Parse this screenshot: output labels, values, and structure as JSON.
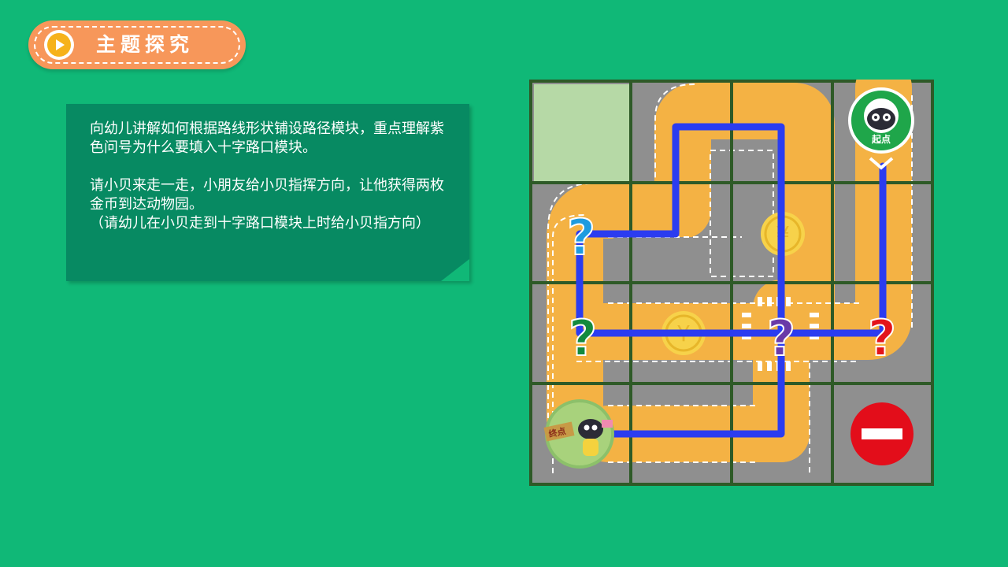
{
  "header": {
    "title": "主题探究",
    "play_icon": "play-icon"
  },
  "note": {
    "paragraph1": "向幼儿讲解如何根据路线形状铺设路径模块，重点理解紫色问号为什么要填入十字路口模块。",
    "paragraph2": "请小贝来走一走，小朋友给小贝指挥方向，让他获得两枚金币到达动物园。",
    "paragraph3": "（请幼儿在小贝走到十字路口模块上时给小贝指方向）"
  },
  "board": {
    "start_badge_text": "起点",
    "end_sign_text": "终点",
    "question_mark": "?",
    "coin_symbol": "¥",
    "colors": {
      "path_line": "#2b3cf0",
      "road": "#f4b244",
      "asphalt": "#8f8f8f",
      "grid": "#2e5a27",
      "empty_tile": "#b6d9a6",
      "q_blue": "#1e9be0",
      "q_green": "#138a3e",
      "q_purple": "#6a3aa8",
      "q_red": "#e3141b",
      "no_entry": "#e30d1a"
    }
  }
}
